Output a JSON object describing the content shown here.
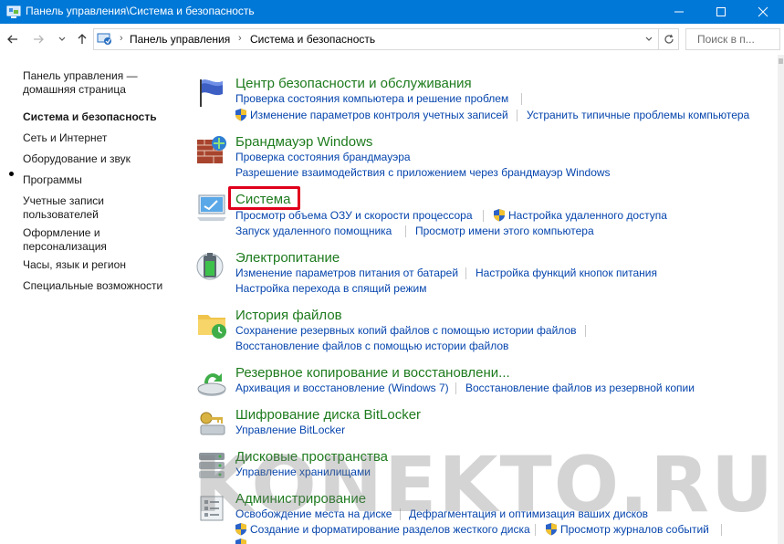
{
  "window": {
    "title": "Панель управления\\Система и безопасность",
    "accent_color": "#0078d7"
  },
  "address": {
    "crumbs": [
      "Панель управления",
      "Система и безопасность"
    ],
    "search_placeholder": "Поиск в п..."
  },
  "sidebar": {
    "items": [
      {
        "label": "Панель управления —"
      },
      {
        "label": "домашняя страница"
      },
      {
        "label": "Система и безопасность",
        "active": true
      },
      {
        "label": "Сеть и Интернет"
      },
      {
        "label": "Оборудование и звук"
      },
      {
        "label": "Программы"
      },
      {
        "label": "Учетные записи"
      },
      {
        "label": "пользователей"
      },
      {
        "label": "Оформление и"
      },
      {
        "label": "персонализация"
      },
      {
        "label": "Часы, язык и регион"
      },
      {
        "label": "Специальные возможности"
      }
    ]
  },
  "categories": [
    {
      "title": "Центр безопасности и обслуживания",
      "icon": "flag-icon",
      "links": [
        "Проверка состояния компьютера и решение проблем",
        "Изменение параметров контроля учетных записей",
        "Устранить типичные проблемы компьютера"
      ]
    },
    {
      "title": "Брандмауэр Windows",
      "icon": "firewall-icon",
      "links": [
        "Проверка состояния брандмауэра",
        "Разрешение взаимодействия с приложением через брандмауэр Windows"
      ]
    },
    {
      "title": "Система",
      "icon": "computer-icon",
      "links": [
        "Просмотр объема ОЗУ и скорости процессора",
        "Настройка удаленного доступа",
        "Запуск удаленного помощника",
        "Просмотр имени этого компьютера"
      ]
    },
    {
      "title": "Электропитание",
      "icon": "battery-icon",
      "links": [
        "Изменение параметров питания от батарей",
        "Настройка функций кнопок питания",
        "Настройка перехода в спящий режим"
      ]
    },
    {
      "title": "История файлов",
      "icon": "file-history-icon",
      "links": [
        "Сохранение резервных копий файлов с помощью истории файлов",
        "Восстановление файлов с помощью истории файлов"
      ]
    },
    {
      "title": "Резервное копирование и восстановлени...",
      "icon": "backup-icon",
      "links": [
        "Архивация и восстановление (Windows 7)",
        "Восстановление файлов из резервной копии"
      ]
    },
    {
      "title": "Шифрование диска BitLocker",
      "icon": "bitlocker-icon",
      "links": [
        "Управление BitLocker"
      ]
    },
    {
      "title": "Дисковые пространства",
      "icon": "storage-spaces-icon",
      "links": [
        "Управление хранилищами"
      ]
    },
    {
      "title": "Администрирование",
      "icon": "admin-tools-icon",
      "links": [
        "Освобождение места на диске",
        "Дефрагментация и оптимизация ваших дисков",
        "Создание и форматирование разделов жесткого диска",
        "Просмотр журналов событий"
      ]
    }
  ],
  "watermark": "KONEKTO.RU",
  "colors": {
    "category_title": "#1e7b1e",
    "link": "#1e5aa8",
    "highlight": "#e0001b"
  }
}
